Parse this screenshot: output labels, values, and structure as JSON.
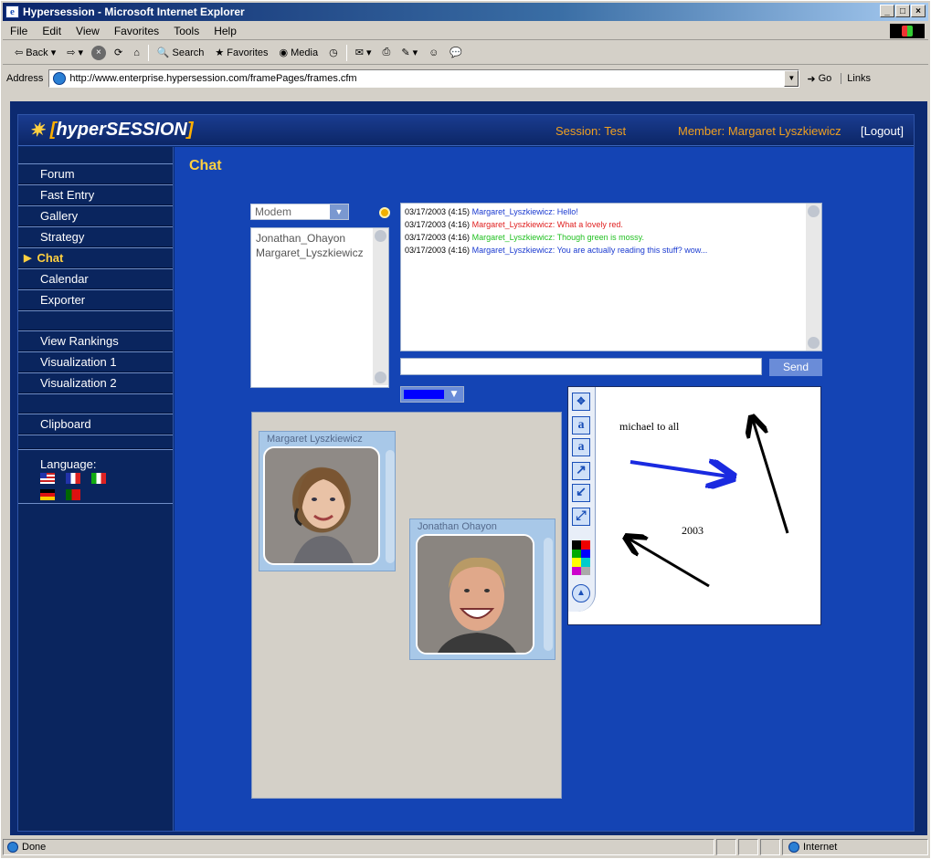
{
  "window": {
    "title": "Hypersession - Microsoft Internet Explorer",
    "buttons": [
      "_",
      "□",
      "×"
    ]
  },
  "menu": [
    "File",
    "Edit",
    "View",
    "Favorites",
    "Tools",
    "Help"
  ],
  "toolbar": {
    "back": "Back",
    "search": "Search",
    "favorites": "Favorites",
    "media": "Media"
  },
  "address": {
    "label": "Address",
    "url": "http://www.enterprise.hypersession.com/framePages/frames.cfm",
    "go": "Go",
    "links": "Links"
  },
  "app": {
    "logo_open": "[",
    "logo_name": "hyperSESSION",
    "logo_close": "]",
    "session": "Session: Test",
    "member": "Member: Margaret Lyszkiewicz",
    "logout": "[Logout]"
  },
  "nav": {
    "items": [
      "Forum",
      "Fast Entry",
      "Gallery",
      "Strategy",
      "Chat",
      "Calendar",
      "Exporter"
    ],
    "items2": [
      "View Rankings",
      "Visualization 1",
      "Visualization 2"
    ],
    "clipboard": "Clipboard",
    "language": "Language:",
    "active": "Chat"
  },
  "chat": {
    "title": "Chat",
    "connection": "Modem",
    "users": [
      "Jonathan_Ohayon",
      "Margaret_Lyszkiewicz"
    ],
    "messages": [
      {
        "time": "03/17/2003 (4:15)",
        "user": "Margaret_Lyszkiewicz:",
        "text": "Hello!",
        "color": "#1a3ad0"
      },
      {
        "time": "03/17/2003 (4:16)",
        "user": "Margaret_Lyszkiewicz:",
        "text": "What a lovely red.",
        "color": "#e02020"
      },
      {
        "time": "03/17/2003 (4:16)",
        "user": "Margaret_Lyszkiewicz:",
        "text": "Though green is mossy.",
        "color": "#22c022"
      },
      {
        "time": "03/17/2003 (4:16)",
        "user": "Margaret_Lyszkiewicz:",
        "text": "You are actually reading this stuff?  wow...",
        "color": "#1a3ad0"
      }
    ],
    "input_value": "",
    "send": "Send",
    "pen_color": "#0000ff"
  },
  "video": {
    "cam1": "Margaret  Lyszkiewicz",
    "cam2": "Jonathan  Ohayon"
  },
  "whiteboard": {
    "text1": "michael to all",
    "text2": "2003",
    "tools": [
      "move-icon",
      "text-icon",
      "text-box-icon",
      "arrow-up-right-icon",
      "arrow-down-left-icon",
      "arrow-both-icon"
    ]
  },
  "status": {
    "left": "Done",
    "zone": "Internet"
  }
}
